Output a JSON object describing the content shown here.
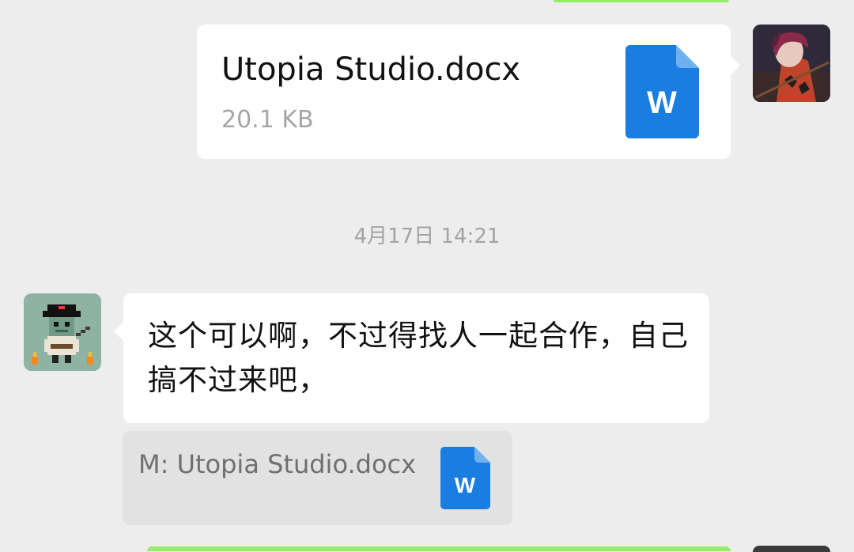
{
  "messages": {
    "outgoing_file": {
      "file_name": "Utopia Studio.docx",
      "file_size": "20.1 KB",
      "icon": "word-document-icon",
      "icon_letter": "W",
      "icon_color": "#1a7ee0"
    },
    "timestamp": "4月17日 14:21",
    "incoming_text": {
      "text": "这个可以啊，不过得找人一起合作，自己搞不过来吧，"
    },
    "quote": {
      "text": "M: Utopia Studio.docx",
      "icon": "word-document-icon",
      "icon_letter": "W"
    }
  },
  "colors": {
    "background": "#ededed",
    "bubble": "#ffffff",
    "outgoing_bubble_accent": "#95ec69",
    "word_blue": "#1a7ee0",
    "quote_bg": "#e2e2e2"
  }
}
